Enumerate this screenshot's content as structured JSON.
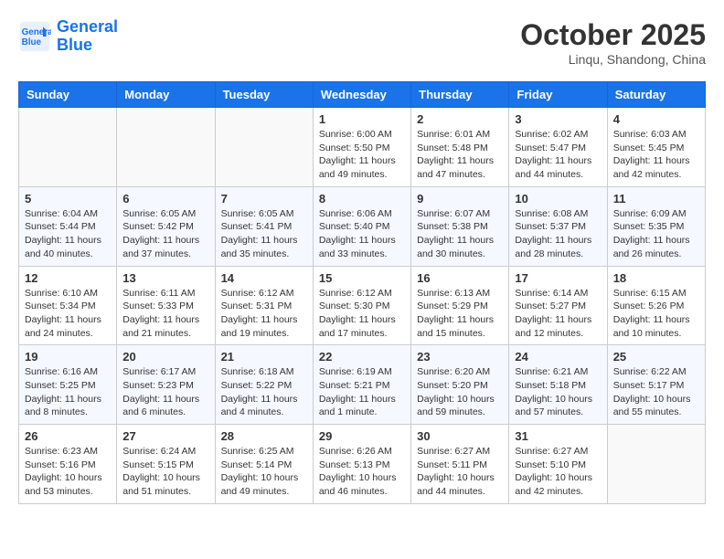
{
  "header": {
    "logo_line1": "General",
    "logo_line2": "Blue",
    "month": "October 2025",
    "location": "Linqu, Shandong, China"
  },
  "days_of_week": [
    "Sunday",
    "Monday",
    "Tuesday",
    "Wednesday",
    "Thursday",
    "Friday",
    "Saturday"
  ],
  "weeks": [
    [
      {
        "day": "",
        "info": ""
      },
      {
        "day": "",
        "info": ""
      },
      {
        "day": "",
        "info": ""
      },
      {
        "day": "1",
        "info": "Sunrise: 6:00 AM\nSunset: 5:50 PM\nDaylight: 11 hours and 49 minutes."
      },
      {
        "day": "2",
        "info": "Sunrise: 6:01 AM\nSunset: 5:48 PM\nDaylight: 11 hours and 47 minutes."
      },
      {
        "day": "3",
        "info": "Sunrise: 6:02 AM\nSunset: 5:47 PM\nDaylight: 11 hours and 44 minutes."
      },
      {
        "day": "4",
        "info": "Sunrise: 6:03 AM\nSunset: 5:45 PM\nDaylight: 11 hours and 42 minutes."
      }
    ],
    [
      {
        "day": "5",
        "info": "Sunrise: 6:04 AM\nSunset: 5:44 PM\nDaylight: 11 hours and 40 minutes."
      },
      {
        "day": "6",
        "info": "Sunrise: 6:05 AM\nSunset: 5:42 PM\nDaylight: 11 hours and 37 minutes."
      },
      {
        "day": "7",
        "info": "Sunrise: 6:05 AM\nSunset: 5:41 PM\nDaylight: 11 hours and 35 minutes."
      },
      {
        "day": "8",
        "info": "Sunrise: 6:06 AM\nSunset: 5:40 PM\nDaylight: 11 hours and 33 minutes."
      },
      {
        "day": "9",
        "info": "Sunrise: 6:07 AM\nSunset: 5:38 PM\nDaylight: 11 hours and 30 minutes."
      },
      {
        "day": "10",
        "info": "Sunrise: 6:08 AM\nSunset: 5:37 PM\nDaylight: 11 hours and 28 minutes."
      },
      {
        "day": "11",
        "info": "Sunrise: 6:09 AM\nSunset: 5:35 PM\nDaylight: 11 hours and 26 minutes."
      }
    ],
    [
      {
        "day": "12",
        "info": "Sunrise: 6:10 AM\nSunset: 5:34 PM\nDaylight: 11 hours and 24 minutes."
      },
      {
        "day": "13",
        "info": "Sunrise: 6:11 AM\nSunset: 5:33 PM\nDaylight: 11 hours and 21 minutes."
      },
      {
        "day": "14",
        "info": "Sunrise: 6:12 AM\nSunset: 5:31 PM\nDaylight: 11 hours and 19 minutes."
      },
      {
        "day": "15",
        "info": "Sunrise: 6:12 AM\nSunset: 5:30 PM\nDaylight: 11 hours and 17 minutes."
      },
      {
        "day": "16",
        "info": "Sunrise: 6:13 AM\nSunset: 5:29 PM\nDaylight: 11 hours and 15 minutes."
      },
      {
        "day": "17",
        "info": "Sunrise: 6:14 AM\nSunset: 5:27 PM\nDaylight: 11 hours and 12 minutes."
      },
      {
        "day": "18",
        "info": "Sunrise: 6:15 AM\nSunset: 5:26 PM\nDaylight: 11 hours and 10 minutes."
      }
    ],
    [
      {
        "day": "19",
        "info": "Sunrise: 6:16 AM\nSunset: 5:25 PM\nDaylight: 11 hours and 8 minutes."
      },
      {
        "day": "20",
        "info": "Sunrise: 6:17 AM\nSunset: 5:23 PM\nDaylight: 11 hours and 6 minutes."
      },
      {
        "day": "21",
        "info": "Sunrise: 6:18 AM\nSunset: 5:22 PM\nDaylight: 11 hours and 4 minutes."
      },
      {
        "day": "22",
        "info": "Sunrise: 6:19 AM\nSunset: 5:21 PM\nDaylight: 11 hours and 1 minute."
      },
      {
        "day": "23",
        "info": "Sunrise: 6:20 AM\nSunset: 5:20 PM\nDaylight: 10 hours and 59 minutes."
      },
      {
        "day": "24",
        "info": "Sunrise: 6:21 AM\nSunset: 5:18 PM\nDaylight: 10 hours and 57 minutes."
      },
      {
        "day": "25",
        "info": "Sunrise: 6:22 AM\nSunset: 5:17 PM\nDaylight: 10 hours and 55 minutes."
      }
    ],
    [
      {
        "day": "26",
        "info": "Sunrise: 6:23 AM\nSunset: 5:16 PM\nDaylight: 10 hours and 53 minutes."
      },
      {
        "day": "27",
        "info": "Sunrise: 6:24 AM\nSunset: 5:15 PM\nDaylight: 10 hours and 51 minutes."
      },
      {
        "day": "28",
        "info": "Sunrise: 6:25 AM\nSunset: 5:14 PM\nDaylight: 10 hours and 49 minutes."
      },
      {
        "day": "29",
        "info": "Sunrise: 6:26 AM\nSunset: 5:13 PM\nDaylight: 10 hours and 46 minutes."
      },
      {
        "day": "30",
        "info": "Sunrise: 6:27 AM\nSunset: 5:11 PM\nDaylight: 10 hours and 44 minutes."
      },
      {
        "day": "31",
        "info": "Sunrise: 6:27 AM\nSunset: 5:10 PM\nDaylight: 10 hours and 42 minutes."
      },
      {
        "day": "",
        "info": ""
      }
    ]
  ]
}
